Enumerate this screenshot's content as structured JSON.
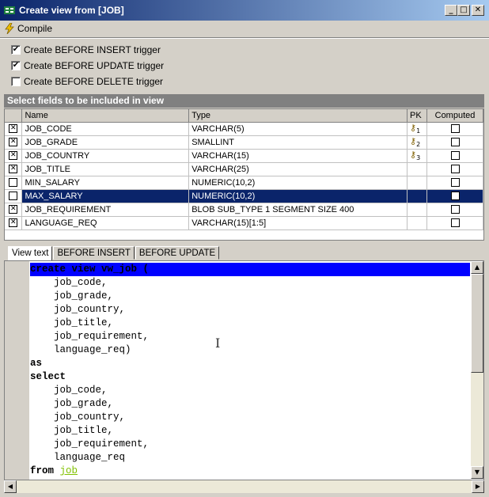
{
  "window": {
    "title": "Create view from [JOB]",
    "minimize_glyph": "_",
    "maximize_glyph": "□",
    "close_glyph": "✕"
  },
  "toolbar": {
    "compile_label": "Compile"
  },
  "options": [
    {
      "label": "Create BEFORE INSERT trigger",
      "checked": true
    },
    {
      "label": "Create BEFORE UPDATE trigger",
      "checked": true
    },
    {
      "label": "Create BEFORE DELETE trigger",
      "checked": false
    }
  ],
  "fields_section": {
    "header": "Select fields to be included in view",
    "columns": [
      "Name",
      "Type",
      "PK",
      "Computed"
    ],
    "rows": [
      {
        "checked": true,
        "name": "JOB_CODE",
        "type": "VARCHAR(5)",
        "pk": "1",
        "computed": false
      },
      {
        "checked": true,
        "name": "JOB_GRADE",
        "type": "SMALLINT",
        "pk": "2",
        "computed": false
      },
      {
        "checked": true,
        "name": "JOB_COUNTRY",
        "type": "VARCHAR(15)",
        "pk": "3",
        "computed": false
      },
      {
        "checked": true,
        "name": "JOB_TITLE",
        "type": "VARCHAR(25)",
        "pk": "",
        "computed": false
      },
      {
        "checked": false,
        "name": "MIN_SALARY",
        "type": "NUMERIC(10,2)",
        "pk": "",
        "computed": false
      },
      {
        "checked": false,
        "name": "MAX_SALARY",
        "type": "NUMERIC(10,2)",
        "pk": "",
        "computed": false,
        "selected": true
      },
      {
        "checked": true,
        "name": "JOB_REQUIREMENT",
        "type": "BLOB SUB_TYPE 1 SEGMENT SIZE 400",
        "pk": "",
        "computed": false
      },
      {
        "checked": true,
        "name": "LANGUAGE_REQ",
        "type": "VARCHAR(15)[1:5]",
        "pk": "",
        "computed": false
      }
    ]
  },
  "tabs": [
    "View text",
    "BEFORE INSERT",
    "BEFORE UPDATE"
  ],
  "active_tab": "View text",
  "code_lines": [
    "create view vw_job (",
    "    job_code,",
    "    job_grade,",
    "    job_country,",
    "    job_title,",
    "    job_requirement,",
    "    language_req)",
    "as",
    "select",
    "    job_code,",
    "    job_grade,",
    "    job_country,",
    "    job_title,",
    "    job_requirement,",
    "    language_req",
    "from job"
  ],
  "colors": {
    "title_gradient_start": "#0a246a",
    "selection": "#0a246a",
    "line_highlight": "#0000ff",
    "table_ref": "#80c000"
  }
}
